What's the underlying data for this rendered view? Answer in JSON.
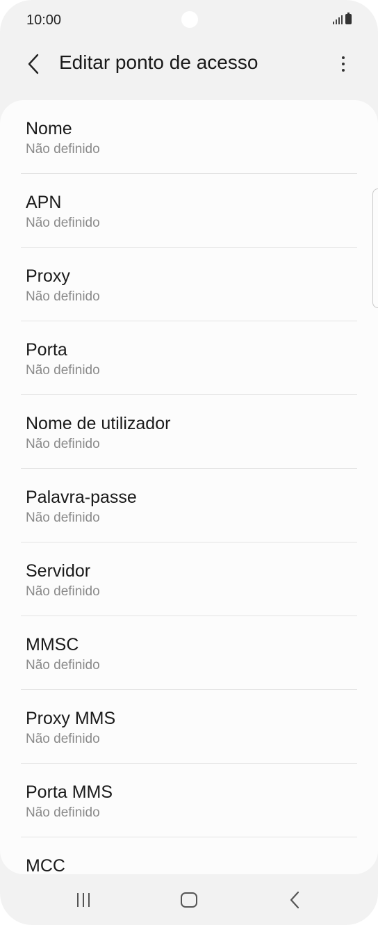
{
  "status_bar": {
    "time": "10:00",
    "icons": [
      "signal-icon",
      "battery-icon"
    ]
  },
  "app_bar": {
    "title": "Editar ponto de acesso",
    "back_icon": "back-arrow-icon",
    "more_icon": "more-options-icon"
  },
  "list": {
    "items": [
      {
        "label": "Nome",
        "value": "Não definido"
      },
      {
        "label": "APN",
        "value": "Não definido"
      },
      {
        "label": "Proxy",
        "value": "Não definido"
      },
      {
        "label": "Porta",
        "value": "Não definido"
      },
      {
        "label": "Nome de utilizador",
        "value": "Não definido"
      },
      {
        "label": "Palavra-passe",
        "value": "Não definido"
      },
      {
        "label": "Servidor",
        "value": "Não definido"
      },
      {
        "label": "MMSC",
        "value": "Não definido"
      },
      {
        "label": "Proxy MMS",
        "value": "Não definido"
      },
      {
        "label": "Porta MMS",
        "value": "Não definido"
      },
      {
        "label": "MCC",
        "value": ""
      }
    ]
  },
  "nav_bar": {
    "icons": [
      "recent-apps-icon",
      "home-icon",
      "back-icon"
    ]
  },
  "colors": {
    "background": "#f2f2f2",
    "card": "#fcfcfc",
    "primary_text": "#1a1a1a",
    "secondary_text": "#8a8a8a",
    "divider": "#e3e3e3"
  }
}
